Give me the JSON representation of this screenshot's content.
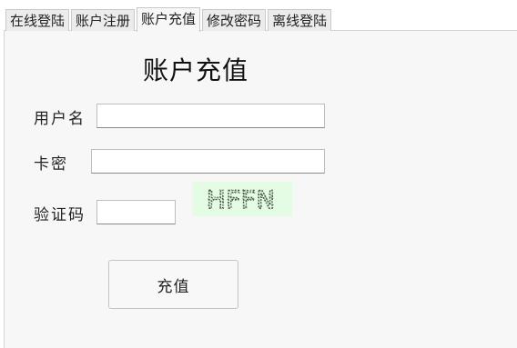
{
  "tabs": [
    {
      "label": "在线登陆"
    },
    {
      "label": "账户注册"
    },
    {
      "label": "账户充值"
    },
    {
      "label": "修改密码"
    },
    {
      "label": "离线登陆"
    }
  ],
  "active_tab": 2,
  "form": {
    "title": "账户充值",
    "username_label": "用户名",
    "username_value": "",
    "card_label": "卡密",
    "card_value": "",
    "captcha_label": "验证码",
    "captcha_value": "",
    "captcha_text": "HFFN",
    "submit_label": "充值"
  },
  "colors": {
    "captcha_bg": "#e4fbe4",
    "captcha_ink": "#4a5a48"
  }
}
